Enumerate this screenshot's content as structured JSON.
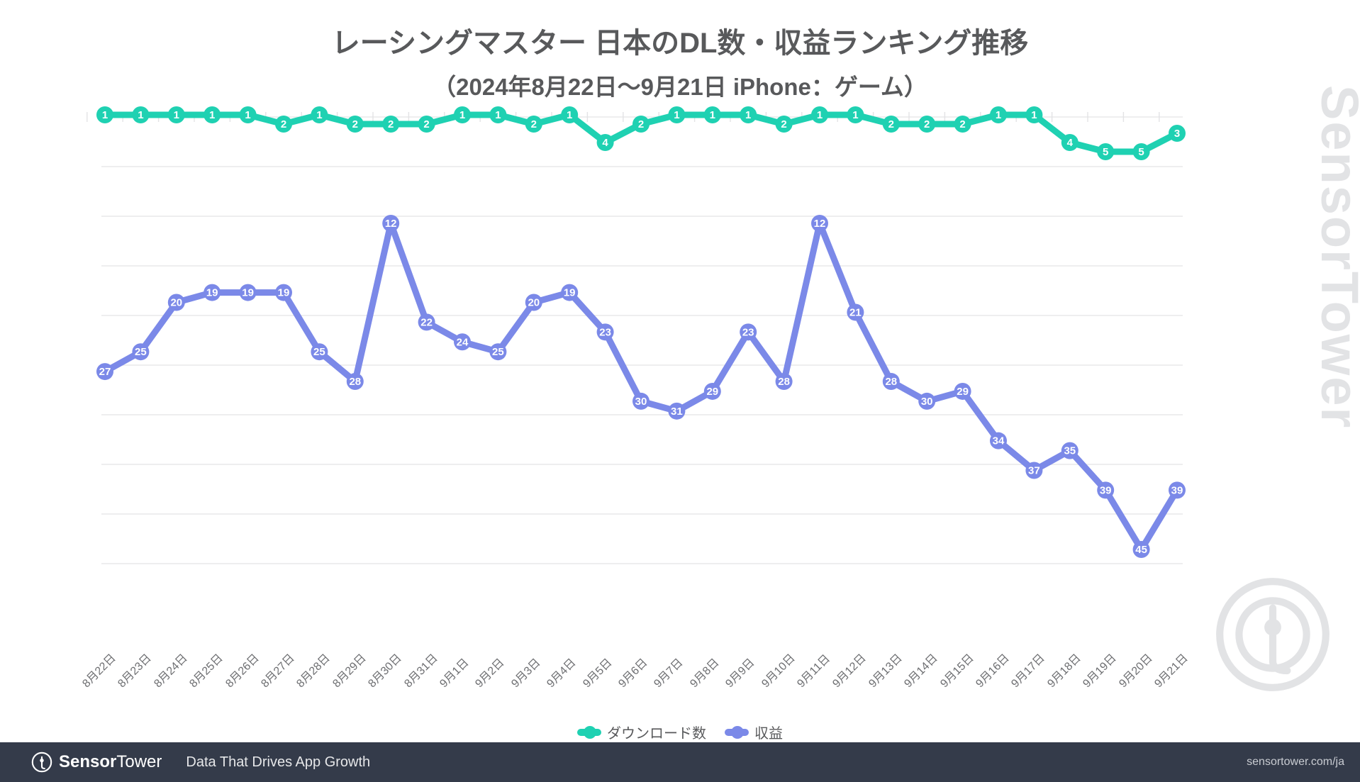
{
  "header": {
    "title": "レーシングマスター 日本のDL数・収益ランキング推移",
    "subtitle": "（2024年8月22日〜9月21日 iPhone：ゲーム）"
  },
  "watermark": {
    "brand_bold": "Sensor",
    "brand_light": "Tower",
    "logo_icon": "sensortower-logo-icon"
  },
  "legend": {
    "items": [
      {
        "label": "ダウンロード数",
        "color": "#1FD1B2"
      },
      {
        "label": "収益",
        "color": "#7B89E8"
      }
    ]
  },
  "footer": {
    "logo_icon": "sensortower-logo-icon",
    "brand_bold": "Sensor",
    "brand_light": "Tower",
    "tagline": "Data That Drives App Growth",
    "url": "sensortower.com/ja"
  },
  "chart_data": {
    "type": "line",
    "title": "レーシングマスター 日本のDL数・収益ランキング推移",
    "subtitle": "（2024年8月22日〜9月21日 iPhone：ゲーム）",
    "xlabel": "",
    "ylabel": "",
    "grid": true,
    "legend_position": "bottom",
    "y_axis_inverted": true,
    "categories": [
      "8月22日",
      "8月23日",
      "8月24日",
      "8月25日",
      "8月26日",
      "8月27日",
      "8月28日",
      "8月29日",
      "8月30日",
      "8月31日",
      "9月1日",
      "9月2日",
      "9月3日",
      "9月4日",
      "9月5日",
      "9月6日",
      "9月7日",
      "9月8日",
      "9月9日",
      "9月10日",
      "9月11日",
      "9月12日",
      "9月13日",
      "9月14日",
      "9月15日",
      "9月16日",
      "9月17日",
      "9月18日",
      "9月19日",
      "9月20日",
      "9月21日"
    ],
    "series": [
      {
        "name": "ダウンロード数",
        "color": "#1FD1B2",
        "values": [
          1,
          1,
          1,
          1,
          1,
          2,
          1,
          2,
          2,
          2,
          1,
          1,
          2,
          1,
          4,
          2,
          1,
          1,
          1,
          2,
          1,
          1,
          2,
          2,
          2,
          1,
          1,
          4,
          5,
          5,
          3
        ]
      },
      {
        "name": "収益",
        "color": "#7B89E8",
        "values": [
          27,
          25,
          20,
          19,
          19,
          19,
          25,
          28,
          12,
          22,
          24,
          25,
          20,
          19,
          23,
          30,
          31,
          29,
          23,
          28,
          12,
          21,
          28,
          30,
          29,
          34,
          37,
          35,
          39,
          45,
          39
        ]
      }
    ],
    "ylim": [
      1,
      48
    ]
  }
}
